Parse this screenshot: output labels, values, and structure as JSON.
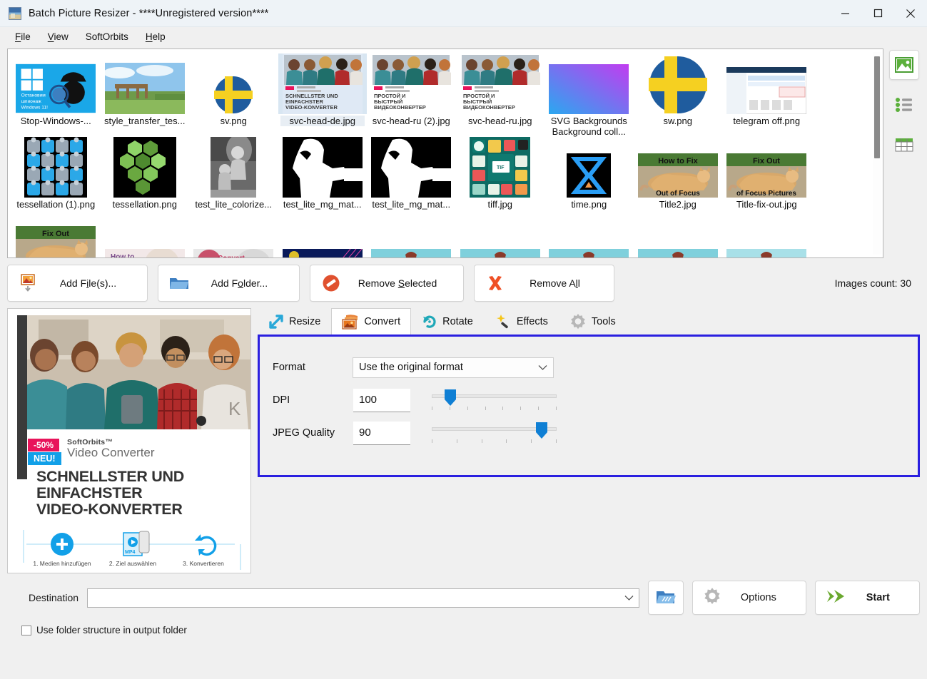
{
  "window": {
    "title": "Batch Picture Resizer - ****Unregistered version****",
    "icon": "app-icon",
    "minimize": "minimize-icon",
    "maximize": "maximize-icon",
    "close": "close-icon"
  },
  "menubar": {
    "items": [
      {
        "label": "File",
        "accel": "F"
      },
      {
        "label": "View",
        "accel": "V"
      },
      {
        "label": "SoftOrbits",
        "accel": ""
      },
      {
        "label": "Help",
        "accel": "H"
      }
    ]
  },
  "view_modes": [
    {
      "name": "thumbnail-view",
      "icon": "image-icon",
      "active": true
    },
    {
      "name": "list-view",
      "icon": "list-icon",
      "active": false
    },
    {
      "name": "table-view",
      "icon": "grid-icon",
      "active": false
    }
  ],
  "thumbnails": {
    "rows": [
      [
        {
          "label": "Stop-Windows-...",
          "kind": "stopwin",
          "selected": false
        },
        {
          "label": "style_transfer_tes...",
          "kind": "bridge",
          "selected": false
        },
        {
          "label": "sv.png",
          "kind": "flag",
          "selected": false
        },
        {
          "label": "svc-head-de.jpg",
          "kind": "svcde",
          "selected": true
        },
        {
          "label": "svc-head-ru (2).jpg",
          "kind": "svcru",
          "selected": false
        },
        {
          "label": "svc-head-ru.jpg",
          "kind": "svcru",
          "selected": false
        },
        {
          "label": "SVG Backgrounds Background coll...",
          "kind": "gradient",
          "selected": false
        },
        {
          "label": "sw.png",
          "kind": "flagcircle",
          "selected": false
        },
        {
          "label": "telegram off.png",
          "kind": "screenshot",
          "selected": false
        }
      ],
      [
        {
          "label": "tessellation (1).png",
          "kind": "puzzle",
          "selected": false
        },
        {
          "label": "tessellation.png",
          "kind": "hexgreen",
          "selected": false
        },
        {
          "label": "test_lite_colorize...",
          "kind": "bwphoto",
          "selected": false
        },
        {
          "label": "test_lite_mg_mat...",
          "kind": "mask",
          "selected": false
        },
        {
          "label": "test_lite_mg_mat...",
          "kind": "mask",
          "selected": false
        },
        {
          "label": "tiff.jpg",
          "kind": "tiff",
          "selected": false
        },
        {
          "label": "time.png",
          "kind": "time",
          "selected": false
        },
        {
          "label": "Title2.jpg",
          "kind": "cat1",
          "selected": false
        },
        {
          "label": "Title-fix-out.jpg",
          "kind": "cat2",
          "selected": false
        }
      ],
      [
        {
          "label": "",
          "kind": "cat3",
          "selected": false
        },
        {
          "label": "",
          "kind": "howto",
          "selected": false
        },
        {
          "label": "",
          "kind": "convert",
          "selected": false
        },
        {
          "label": "",
          "kind": "neon",
          "selected": false
        },
        {
          "label": "",
          "kind": "beach",
          "selected": false
        },
        {
          "label": "",
          "kind": "beach",
          "selected": false
        },
        {
          "label": "",
          "kind": "beach",
          "selected": false
        },
        {
          "label": "",
          "kind": "beach",
          "selected": false
        },
        {
          "label": "",
          "kind": "beach2",
          "selected": false
        }
      ]
    ]
  },
  "actions": {
    "add_files": {
      "label": "Add File(s)...",
      "pre": "Add F",
      "accel": "i",
      "post": "le(s)...",
      "icon": "add-image-icon"
    },
    "add_folder": {
      "label": "Add Folder...",
      "pre": "Add F",
      "accel": "o",
      "post": "lder...",
      "icon": "folder-icon"
    },
    "remove_selected": {
      "label": "Remove Selected",
      "pre": "Remove ",
      "accel": "S",
      "post": "elected",
      "icon": "no-entry-icon"
    },
    "remove_all": {
      "label": "Remove All",
      "pre": "Remove A",
      "accel": "l",
      "post": "l",
      "icon": "red-x-icon"
    },
    "images_count": "Images count: 30"
  },
  "tabs": [
    {
      "label": "Resize",
      "icon": "resize-arrows-icon",
      "active": false
    },
    {
      "label": "Convert",
      "icon": "convert-image-icon",
      "active": true
    },
    {
      "label": "Rotate",
      "icon": "rotate-icon",
      "active": false
    },
    {
      "label": "Effects",
      "icon": "magic-wand-icon",
      "active": false
    },
    {
      "label": "Tools",
      "icon": "gear-icon",
      "active": false
    }
  ],
  "convert_panel": {
    "highlight_color": "#2a1fe0",
    "format": {
      "label": "Format",
      "value": "Use the original format",
      "chevron": "chevron-down-icon"
    },
    "dpi": {
      "label": "DPI",
      "value": "100",
      "slider_percent": 15,
      "ticks": 8
    },
    "jpeg_quality": {
      "label": "JPEG Quality",
      "value": "90",
      "slider_percent": 88,
      "ticks": 6
    }
  },
  "preview": {
    "badge_discount": "-50%",
    "badge_new": "NEU!",
    "brand": "SoftOrbits™",
    "product": "Video Converter",
    "headline_line1": "SCHNELLSTER UND",
    "headline_line2": "EINFACHSTER",
    "headline_line3": "VIDEO-KONVERTER",
    "steps": [
      "1. Medien hinzufügen",
      "2. Ziel auswählen",
      "3. Konvertieren"
    ],
    "step_icons": [
      "plus-icon",
      "mp4-file-icon",
      "refresh-icon"
    ]
  },
  "bottom": {
    "destination_label": "Destination",
    "destination_value": "",
    "destination_placeholder": "",
    "browse_icon": "browse-folder-icon",
    "options_label": "Options",
    "options_icon": "gear-icon",
    "start_label": "Start",
    "start_icon": "green-arrows-icon",
    "checkbox_label": "Use folder structure in output folder",
    "checkbox_checked": false
  }
}
